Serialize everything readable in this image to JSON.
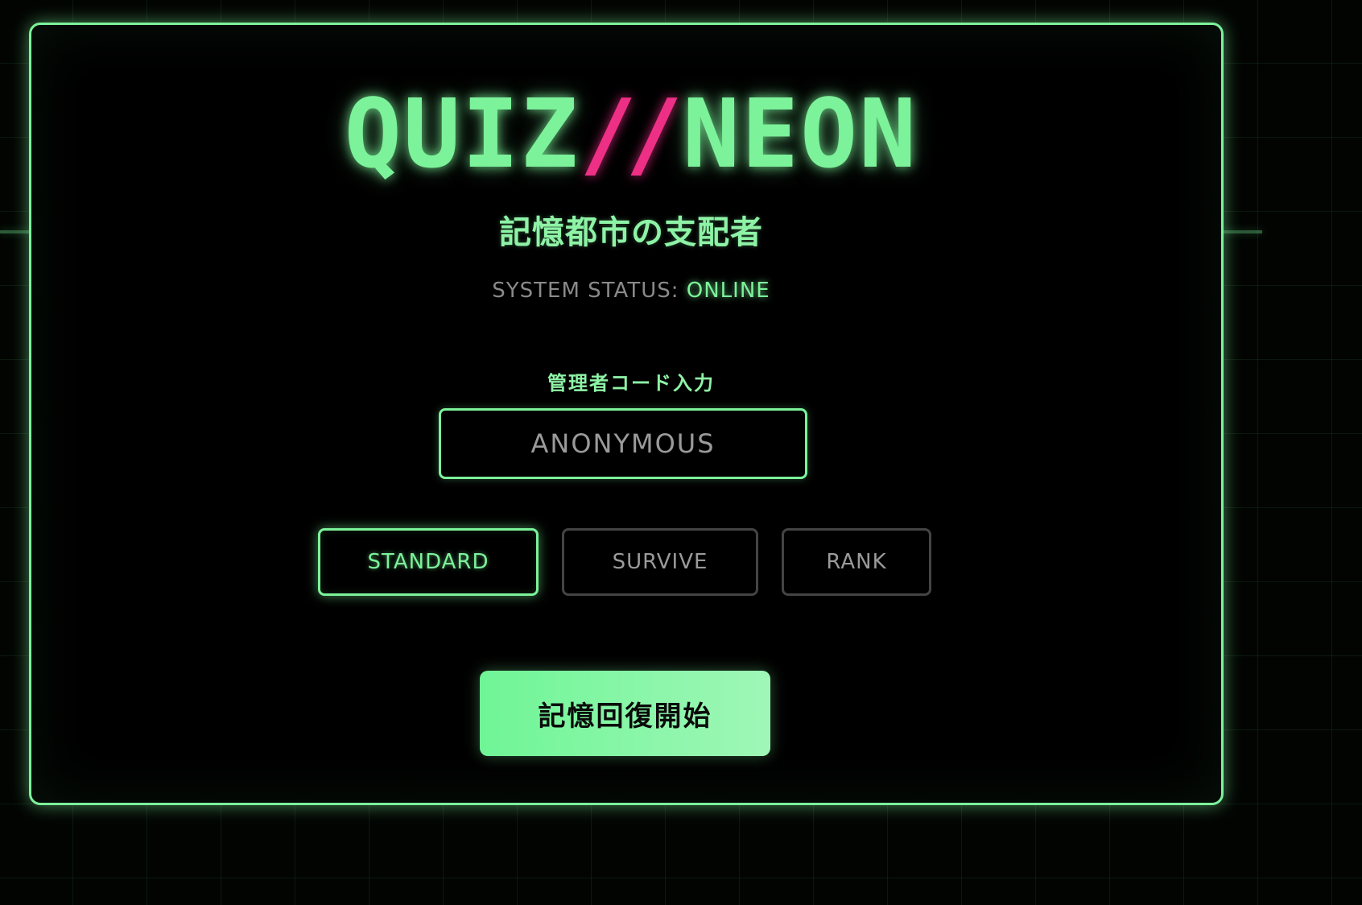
{
  "header": {
    "title_left": "QUIZ",
    "title_slash": "//",
    "title_right": "NEON",
    "subtitle": "記憶都市の支配者"
  },
  "status": {
    "label": "SYSTEM STATUS: ",
    "value": "ONLINE"
  },
  "code_entry": {
    "label": "管理者コード入力",
    "placeholder": "ANONYMOUS",
    "value": ""
  },
  "modes": {
    "selected": "STANDARD",
    "items": [
      {
        "label": "STANDARD"
      },
      {
        "label": "SURVIVE"
      },
      {
        "label": "RANK"
      }
    ]
  },
  "start_button": {
    "label": "記憶回復開始"
  },
  "colors": {
    "accent": "#7cf29a",
    "slash": "#ee2f86",
    "background": "#000000",
    "inactive_border": "#444444",
    "muted_text": "#9a9a9a"
  }
}
